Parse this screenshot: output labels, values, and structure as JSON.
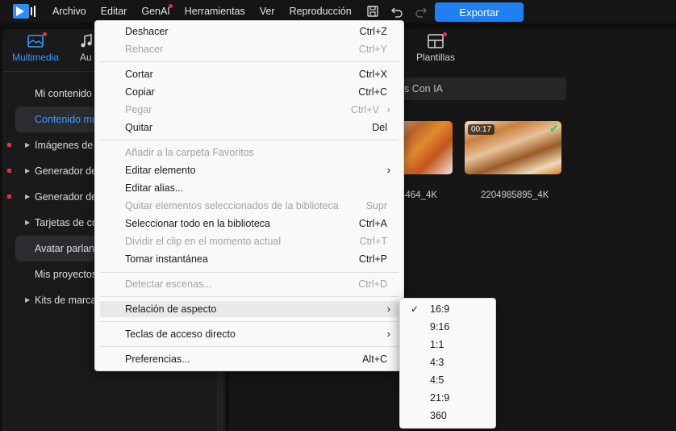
{
  "menu_bar": {
    "items": [
      "Archivo",
      "Editar",
      "GenAI",
      "Herramientas",
      "Ver",
      "Reproducción"
    ],
    "export_label": "Exportar"
  },
  "left_panel": {
    "tabs": {
      "multimedia": "Multimedia",
      "audio_partial": "Au"
    },
    "nav": [
      "Mi contenido",
      "Contenido mu",
      "Imágenes de f",
      "Generador de",
      "Generador de",
      "Tarjetas de co",
      "Avatar parlant",
      "Mis proyectos",
      "Kits de marca"
    ]
  },
  "right_panel": {
    "tab_plantillas": "Plantillas",
    "search_partial": "os Con IA",
    "thumbs": [
      {
        "caption": "4464_4K"
      },
      {
        "caption": "2204985895_4K",
        "duration": "00:17"
      }
    ]
  },
  "context_menu": {
    "items": [
      {
        "label": "Deshacer",
        "shortcut": "Ctrl+Z"
      },
      {
        "label": "Rehacer",
        "shortcut": "Ctrl+Y"
      },
      {
        "label": "Cortar",
        "shortcut": "Ctrl+X"
      },
      {
        "label": "Copiar",
        "shortcut": "Ctrl+C"
      },
      {
        "label": "Pegar",
        "shortcut": "Ctrl+V"
      },
      {
        "label": "Quitar",
        "shortcut": "Del"
      },
      {
        "label": "Añadir a la carpeta Favoritos"
      },
      {
        "label": "Editar elemento"
      },
      {
        "label": "Editar alias..."
      },
      {
        "label": "Quitar elementos seleccionados de la biblioteca",
        "shortcut": "Supr"
      },
      {
        "label": "Seleccionar todo en la biblioteca",
        "shortcut": "Ctrl+A"
      },
      {
        "label": "Dividir el clip en el momento actual",
        "shortcut": "Ctrl+T"
      },
      {
        "label": "Tomar instantánea",
        "shortcut": "Ctrl+P"
      },
      {
        "label": "Detectar escenas...",
        "shortcut": "Ctrl+D"
      },
      {
        "label": "Relación de aspecto"
      },
      {
        "label": "Teclas de acceso directo"
      },
      {
        "label": "Preferencias...",
        "shortcut": "Alt+C"
      }
    ]
  },
  "aspect_submenu": {
    "items": [
      "16:9",
      "9:16",
      "1:1",
      "4:3",
      "4:5",
      "21:9",
      "360"
    ],
    "checked_mark": "✓"
  },
  "colors": {
    "accent": "#1f7ff0",
    "highlight_text": "#3a9bff",
    "notify_dot": "#e8303a"
  }
}
